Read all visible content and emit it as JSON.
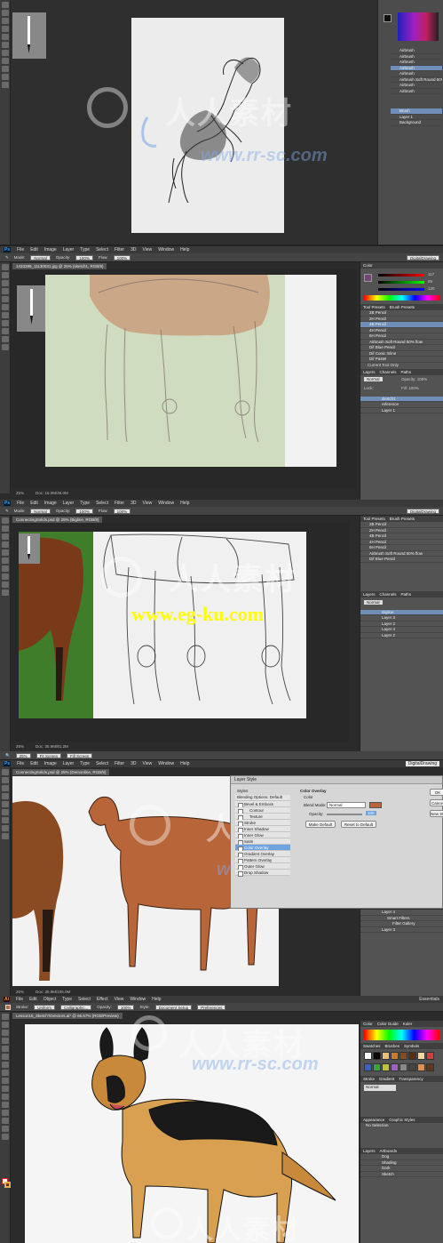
{
  "frame1": {
    "watermark_cn": "人人素材",
    "watermark_url": "www.rr-sc.com",
    "layers": [
      "Brush",
      "Layer 1",
      "Background"
    ],
    "brush_list": [
      "Airbrush",
      "Airbrush",
      "Airbrush",
      "Airbrush",
      "Airbrush",
      "Airbrush Soft Round 50%",
      "Airbrush",
      "Airbrush"
    ]
  },
  "frame2": {
    "app_logo": "Ps",
    "menu": [
      "File",
      "Edit",
      "Image",
      "Layer",
      "Type",
      "Select",
      "Filter",
      "3D",
      "View",
      "Window",
      "Help"
    ],
    "options": {
      "mode_label": "Mode:",
      "mode_value": "Normal",
      "opacity_label": "Opacity:",
      "opacity_value": "100%",
      "flow_label": "Flow:",
      "flow_value": "100%"
    },
    "workspace": "DigitalDrawing",
    "doc_tab": "1433289_11130031.jpg @ 25% (sketch1, RGB/8)",
    "status_zoom": "25%",
    "status_doc": "Doc: 16.0M/46.0M",
    "color_tab": "Color",
    "color_values": {
      "r": "117",
      "g": "69",
      "b": "120"
    },
    "tool_presets_tabs": [
      "Tool Presets",
      "Brush Presets"
    ],
    "tool_presets": [
      "2B Pencil",
      "2H Pencil",
      "4B Pencil",
      "4H Pencil",
      "6H Pencil",
      "Airbrush Soft Round 50% flow",
      "Dif Blue Pencil",
      "Dif Conic Inline",
      "Dif Pastel"
    ],
    "tool_presets_selected": 2,
    "current_tool_only": "Current Tool Only",
    "layers_tabs": [
      "Layers",
      "Channels",
      "Paths"
    ],
    "layers": [
      "sketch1",
      "reference",
      "Layer 1"
    ],
    "layers_selected": 0,
    "blend_mode": "Normal",
    "opacity": "Opacity: 100%",
    "fill": "Fill: 100%",
    "lock": "Lock:"
  },
  "frame3": {
    "app_logo": "Ps",
    "menu": [
      "File",
      "Edit",
      "Image",
      "Layer",
      "Type",
      "Select",
      "Filter",
      "3D",
      "View",
      "Window",
      "Help"
    ],
    "options": {
      "mode_label": "Mode:",
      "mode_value": "Normal",
      "opacity_label": "Opacity:",
      "opacity_value": "100%",
      "flow_label": "Flow:",
      "flow_value": "100%"
    },
    "workspace": "DigitalDrawing",
    "doc_tab": "ConnectingSolids.psd @ 25% (Bigline, RGB/8)",
    "status_zoom": "25%",
    "status_doc": "Doc: 35.9M/81.2M",
    "watermark_cn": "人人素材",
    "watermark_yellow": "www.eg-ku.com",
    "tool_presets": [
      "2B Pencil",
      "2H Pencil",
      "4B Pencil",
      "4H Pencil",
      "6H Pencil",
      "Airbrush Soft Round 50% flow",
      "Dif Blue Pencil"
    ],
    "layers": [
      "Bigline",
      "Layer 3",
      "Layer 2",
      "Layer 4",
      "Layer 2"
    ],
    "layers_selected": 0,
    "blend_mode": "Normal"
  },
  "frame4": {
    "toolbar_buttons": [
      "25%",
      "Fit Screen",
      "Fill Screen"
    ],
    "menu": [
      "File",
      "Edit",
      "Image",
      "Layer",
      "Type",
      "Select",
      "Filter",
      "3D",
      "View",
      "Window",
      "Help"
    ],
    "workspace": "DigitalDrawing",
    "doc_tab": "ConnectingSolids.psd @ 25% (Demonline, RGB/8)",
    "status_zoom": "25%",
    "status_doc": "Doc: 35.9M/106.0M",
    "watermark_cn": "人人素材",
    "watermark_url": "www.rr-sc.com",
    "dialog": {
      "title": "Layer Style",
      "list_header": "Styles",
      "blending_options": "Blending Options: Default",
      "items": [
        "Bevel & Emboss",
        "Contour",
        "Texture",
        "Stroke",
        "Inner Shadow",
        "Inner Glow",
        "Satin",
        "Color Overlay",
        "Gradient Overlay",
        "Pattern Overlay",
        "Outer Glow",
        "Drop Shadow"
      ],
      "selected": 7,
      "section_title": "Color Overlay",
      "section_sub": "Color",
      "blend_mode_label": "Blend Mode:",
      "blend_mode_value": "Normal",
      "opacity_label": "Opacity:",
      "opacity_value": "100",
      "make_default": "Make Default",
      "reset_default": "Reset to Default",
      "overlay_color": "#b8653a",
      "side_buttons": [
        "OK",
        "Cancel",
        "New Style..."
      ]
    },
    "layers": [
      "Layer 4",
      "Smart Filters",
      "Filter Gallery",
      "Layer 3"
    ]
  },
  "frame5": {
    "app_logo": "Ai",
    "menu": [
      "File",
      "Edit",
      "Object",
      "Type",
      "Select",
      "Effect",
      "View",
      "Window",
      "Help"
    ],
    "workspace": "Essentials",
    "options": {
      "stroke_label": "Stroke:",
      "uniform": "Uniform",
      "brush": "Calligraphic...",
      "opacity_label": "Opacity:",
      "opacity_value": "100%",
      "style_label": "Style:",
      "doc_setup": "Document Setup",
      "preferences": "Preferences"
    },
    "doc_tab": "Lesson16_SketchToVectors.ai* @ 66.67% (RGB/Preview)",
    "watermark_cn": "人人素材",
    "watermark_url": "www.rr-sc.com",
    "panel_tabs": [
      "Color",
      "Color Guide",
      "Kuler"
    ],
    "swatches_tabs": [
      "Swatches",
      "Brushes",
      "Symbols"
    ],
    "appearance_title": "Appearance",
    "appearance_graphic_styles": "Graphic Styles",
    "appearance_no_selection": "No Selection",
    "transparency_tabs": [
      "Stroke",
      "Gradient",
      "Transparency"
    ],
    "transparency_mode": "Normal",
    "layers_tabs": [
      "Layers",
      "Artboards"
    ],
    "layers": [
      "Dog",
      "Shading",
      "Dark",
      "Sketch"
    ],
    "swatch_colors": [
      "#ffffff",
      "#000000",
      "#e8c070",
      "#c87a30",
      "#8a4a20",
      "#5a3010",
      "#f0d8a0",
      "#d04040",
      "#4060c0",
      "#40a040",
      "#c0c040",
      "#a060c0",
      "#888888",
      "#444444",
      "#e09050",
      "#603820"
    ]
  }
}
